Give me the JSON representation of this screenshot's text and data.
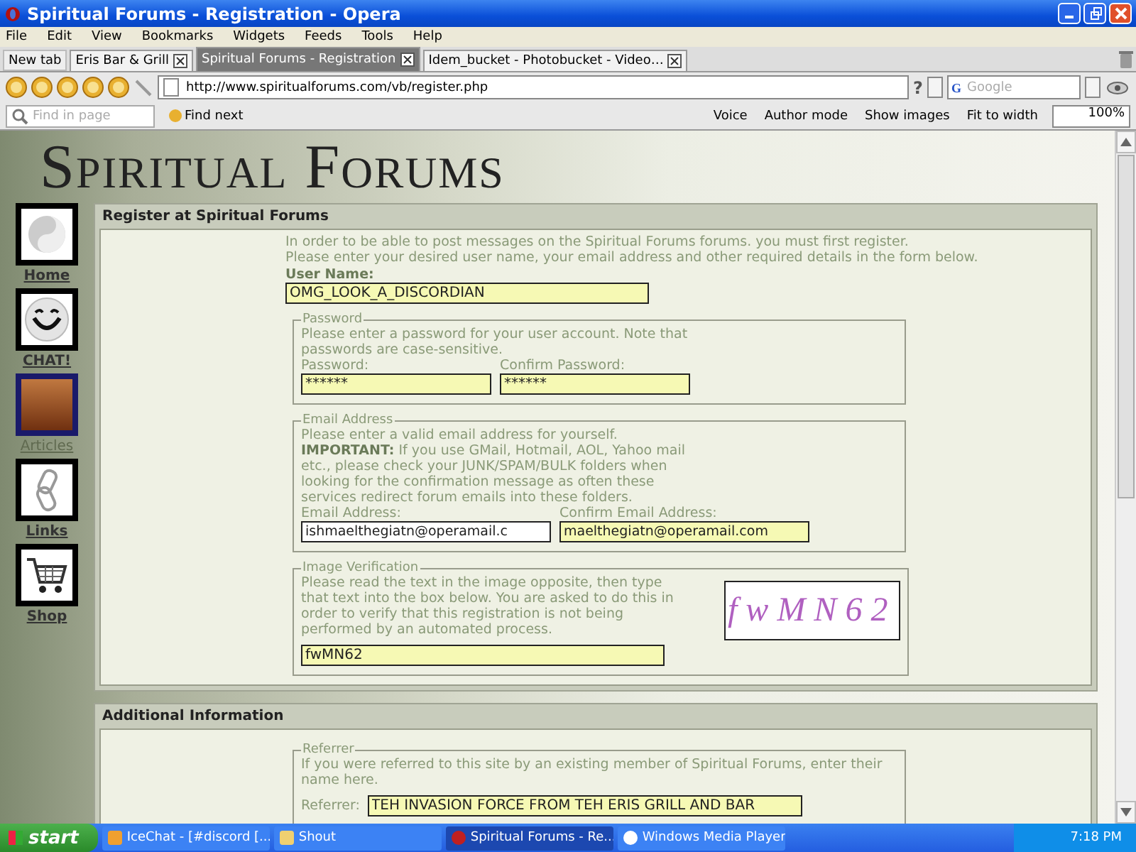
{
  "window": {
    "title": "Spiritual Forums - Registration - Opera"
  },
  "menu": [
    "File",
    "Edit",
    "View",
    "Bookmarks",
    "Widgets",
    "Feeds",
    "Tools",
    "Help"
  ],
  "new_tab_button": "New tab",
  "tabs": [
    {
      "label": "Eris Bar & Grill",
      "selected": false
    },
    {
      "label": "Spiritual Forums - Registration",
      "selected": true
    },
    {
      "label": "Idem_bucket - Photobucket - Video…",
      "selected": false
    }
  ],
  "address_bar": {
    "url": "http://www.spiritualforums.com/vb/register.php",
    "help": "?"
  },
  "search": {
    "engine": "G",
    "placeholder": "Google"
  },
  "toolbar": {
    "find_placeholder": "Find in page",
    "find_next": "Find next",
    "voice": "Voice",
    "author_mode": "Author mode",
    "show_images": "Show images",
    "fit_to_width": "Fit to width",
    "zoom": "100%"
  },
  "site": {
    "title": "Spiritual Forums"
  },
  "nav": [
    {
      "label": "Home",
      "kind": "yinyang",
      "selected": false
    },
    {
      "label": "CHAT!",
      "kind": "smiley",
      "selected": false
    },
    {
      "label": "Articles",
      "kind": "photo",
      "selected": true
    },
    {
      "label": "Links",
      "kind": "chain",
      "selected": false
    },
    {
      "label": "Shop",
      "kind": "cart",
      "selected": false
    }
  ],
  "register": {
    "title": "Register at Spiritual Forums",
    "intro": [
      "In order to be able to post messages on the Spiritual Forums forums. you must first register.",
      "Please enter your desired user name, your email address and other required details in the form below."
    ],
    "username": {
      "label": "User Name:",
      "value": "OMG_LOOK_A_DISCORDIAN",
      "highlighted": true
    },
    "password": {
      "legend": "Password",
      "text": [
        "Please enter a password for your user account. Note that passwords are case-sensitive."
      ],
      "fields": [
        {
          "label": "Password:",
          "value": "******",
          "highlighted": true
        },
        {
          "label": "Confirm Password:",
          "value": "******",
          "highlighted": true
        }
      ]
    },
    "email": {
      "legend": "Email Address",
      "text": [
        "Please enter a valid email address for yourself.",
        "**IMPORTANT:** If you use GMail, Hotmail, AOL, Yahoo mail etc., please check your JUNK/SPAM/BULK folders when looking for the confirmation message as often these services redirect forum emails into these folders."
      ],
      "fields": [
        {
          "label": "Email Address:",
          "value": "ishmaelthegiatn@operamail.c",
          "highlighted": false
        },
        {
          "label": "Confirm Email Address:",
          "value": "maelthegiatn@operamail.com",
          "highlighted": true
        }
      ]
    },
    "verification": {
      "legend": "Image Verification",
      "text": [
        "Please read the text in the image opposite, then type that text into the box below. You are asked to do this in order to verify that this registration is not being performed by an automated process."
      ],
      "field": {
        "value": "fwMN62",
        "highlighted": true
      },
      "captcha": "fwMN62"
    }
  },
  "additional": {
    "title": "Additional Information",
    "referrer": {
      "legend": "Referrer",
      "text": "If you were referred to this site by an existing member of Spiritual Forums, enter their name here.",
      "label": "Referrer:",
      "value": "TEH INVASION FORCE FROM TEH ERIS GRILL AND BAR",
      "highlighted": true
    }
  },
  "taskbar": {
    "start": "start",
    "items": [
      {
        "label": "IceChat - [#discord [...",
        "selected": false,
        "kind": "chat"
      },
      {
        "label": "Shout",
        "selected": false,
        "kind": "folder"
      },
      {
        "label": "Spiritual Forums - Re...",
        "selected": true,
        "kind": "browser"
      },
      {
        "label": "Windows Media Player",
        "selected": false,
        "kind": "player"
      }
    ],
    "time": "7:18 PM"
  }
}
